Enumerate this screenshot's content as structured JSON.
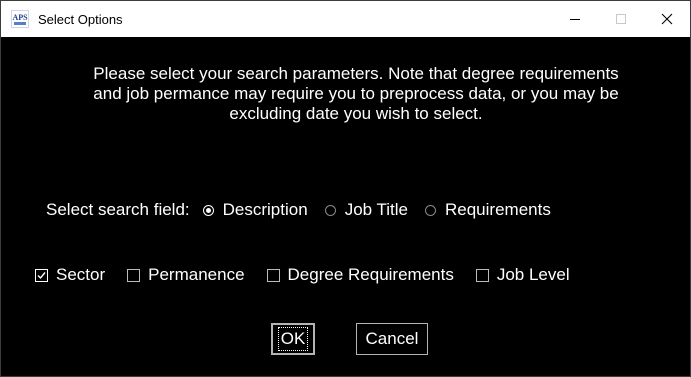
{
  "window": {
    "title": "Select Options",
    "app_icon": "aps-physics-icon",
    "app_icon_text": "APS"
  },
  "title_controls": {
    "minimize_icon": "minimize-icon",
    "maximize_icon": "maximize-icon",
    "close_icon": "close-icon"
  },
  "message": "Please select your search parameters. Note that degree requirements and job permance may require you to preprocess data, or you may be excluding date you wish to select.",
  "search_field": {
    "label": "Select search field:",
    "options": [
      {
        "label": "Description",
        "selected": true
      },
      {
        "label": "Job Title",
        "selected": false
      },
      {
        "label": "Requirements",
        "selected": false
      }
    ]
  },
  "filters": [
    {
      "label": "Sector",
      "checked": true
    },
    {
      "label": "Permanence",
      "checked": false
    },
    {
      "label": "Degree Requirements",
      "checked": false
    },
    {
      "label": "Job Level",
      "checked": false
    }
  ],
  "buttons": {
    "ok_label": "OK",
    "cancel_label": "Cancel"
  },
  "colors": {
    "background": "#000000",
    "text": "#ffffff",
    "titlebar": "#ffffff",
    "button_border": "#b4b4b4"
  }
}
